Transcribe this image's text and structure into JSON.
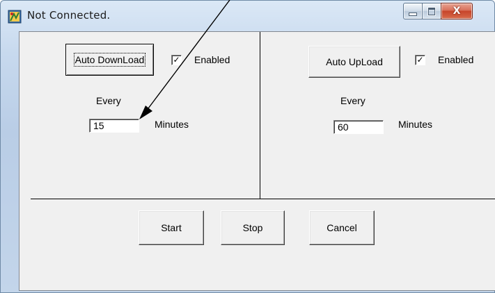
{
  "window": {
    "title": "Not Connected.",
    "icons": {
      "app": "app-icon",
      "minimize": "minimize-icon",
      "maximize": "maximize-icon",
      "close": "close-icon"
    },
    "close_glyph": "X"
  },
  "download": {
    "button_label": "Auto DownLoad",
    "enabled_label": "Enabled",
    "enabled_checked": true,
    "every_label": "Every",
    "minutes_value": "15",
    "minutes_label": "Minutes"
  },
  "upload": {
    "button_label": "Auto UpLoad",
    "enabled_label": "Enabled",
    "enabled_checked": true,
    "every_label": "Every",
    "minutes_value": "60",
    "minutes_label": "Minutes"
  },
  "footer": {
    "start_label": "Start",
    "stop_label": "Stop",
    "cancel_label": "Cancel"
  },
  "check_glyph": "✓",
  "colors": {
    "close_button": "#c7452b",
    "frame": "#c7d9ee",
    "annotation_arrow": "#000000"
  }
}
